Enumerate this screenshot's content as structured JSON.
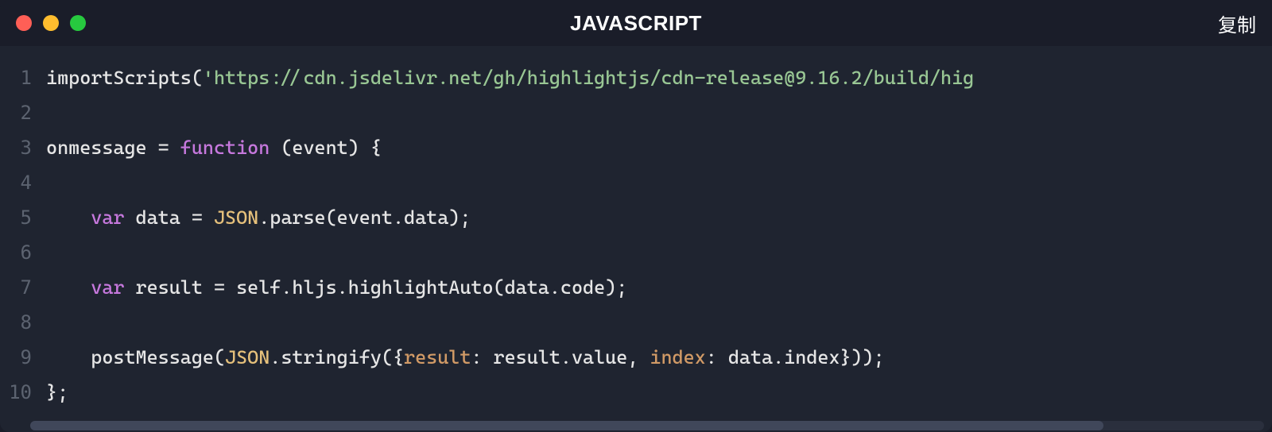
{
  "titlebar": {
    "title": "JAVASCRIPT",
    "copy_label": "复制"
  },
  "gutter": {
    "numbers": [
      "1",
      "2",
      "3",
      "4",
      "5",
      "6",
      "7",
      "8",
      "9",
      "10"
    ]
  },
  "code": {
    "line1": {
      "fn": "importScripts",
      "open": "(",
      "str": "'https://cdn.jsdelivr.net/gh/highlightjs/cdn-release@9.16.2/build/hig"
    },
    "line3": {
      "lhs": "onmessage ",
      "eq": "= ",
      "kw": "function",
      "rest": " (event) {"
    },
    "line5": {
      "indent": "    ",
      "kw": "var",
      "sp": " data = ",
      "cls": "JSON",
      "rest": ".parse(event.data);"
    },
    "line7": {
      "indent": "    ",
      "kw": "var",
      "rest": " result = self.hljs.highlightAuto(data.code);"
    },
    "line9": {
      "indent": "    ",
      "fn": "postMessage(",
      "cls": "JSON",
      "method": ".stringify({",
      "prop1": "result",
      "mid": ": result.value, ",
      "prop2": "index",
      "end": ": data.index}));"
    },
    "line10": {
      "text": "};"
    }
  }
}
